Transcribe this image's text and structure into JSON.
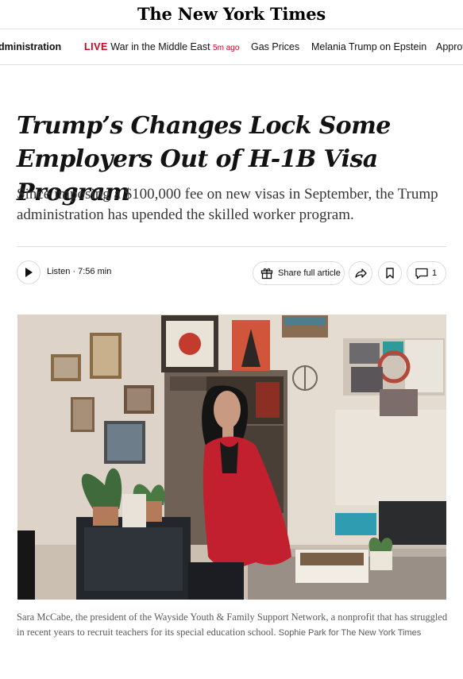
{
  "masthead": {
    "logo_text": "The New York Times"
  },
  "nav": {
    "items": [
      {
        "label": "dministration"
      },
      {
        "badge": "LIVE",
        "label": "War in the Middle East",
        "time": "5m ago"
      },
      {
        "label": "Gas Prices"
      },
      {
        "label": "Melania Trump on Epstein"
      },
      {
        "label": "Approv"
      }
    ]
  },
  "article": {
    "headline_line1": "Trump’s Changes Lock Some",
    "headline_line2": "Employers Out of H-1B Visa Program",
    "summary": "Since imposing a $100,000 fee on new visas in September, the Trump administration has upended the skilled worker program."
  },
  "toolbar": {
    "listen_label": "Listen · 7:56 min",
    "share_label": "Share full article",
    "comment_count": "1"
  },
  "photo": {
    "caption": "Sara McCabe, the president of the Wayside Youth & Family Support Network, a nonprofit that has struggled in recent years to recruit teachers for its special education school.",
    "credit": "Sophie Park for The New York Times"
  },
  "colors": {
    "live_red": "#d0021b",
    "jacket_red": "#c2202e",
    "wall": "#e4dbd1"
  },
  "icons": [
    "play-icon",
    "gift-icon",
    "share-arrow-icon",
    "bookmark-icon",
    "comment-icon"
  ]
}
